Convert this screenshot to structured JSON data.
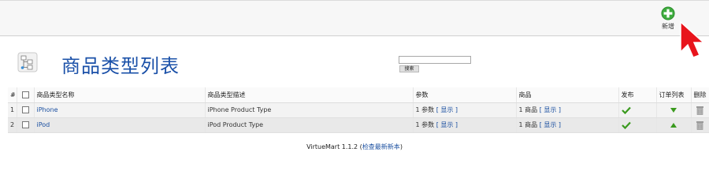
{
  "toolbar": {
    "new_label": "新增",
    "accent_color": "#3eac3e"
  },
  "header": {
    "title": "商品类型列表",
    "search_placeholder": "",
    "search_value": "",
    "search_button": "搜索"
  },
  "table": {
    "columns": [
      "#",
      "",
      "商品类型名称",
      "商品类型描述",
      "参数",
      "商品",
      "发布",
      "订单列表",
      "删除"
    ],
    "rows": [
      {
        "num": "1",
        "name": "iPhone",
        "description": "iPhone Product Type",
        "params_count": "1 参数",
        "params_link": "[ 显示 ]",
        "products_count": "1 商品",
        "products_link": "[ 显示 ]",
        "published": true,
        "order_direction": "down"
      },
      {
        "num": "2",
        "name": "iPod",
        "description": "iPod Product Type",
        "params_count": "1 参数",
        "params_link": "[ 显示 ]",
        "products_count": "1 商品",
        "products_link": "[ 显示 ]",
        "published": true,
        "order_direction": "up"
      }
    ]
  },
  "footer": {
    "version": "VirtueMart 1.1.2",
    "open_paren": " (",
    "update_link": "检查最新新本",
    "close_paren": ")"
  }
}
